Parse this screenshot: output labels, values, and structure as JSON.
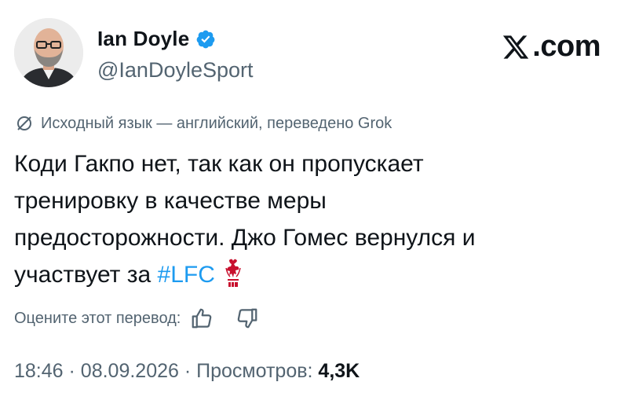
{
  "author": {
    "name": "Ian Doyle",
    "handle": "@IanDoyleSport",
    "verified": true
  },
  "brand": {
    "text": ".com",
    "icon": "x-logo-icon"
  },
  "translation": {
    "note": "Исходный язык — английский, переведено Grok",
    "icon": "translate-slash-icon"
  },
  "tweet": {
    "line1": "Коди Гакпо нет, так как он пропускает",
    "line2": "тренировку в качестве меры",
    "line3": "предосторожности. Джо Гомес вернулся и",
    "line4_prefix": "участвует за ",
    "hashtag": "#LFC",
    "emoji_icon": "lfc-crest-icon"
  },
  "rating": {
    "label": "Оцените этот перевод:",
    "thumbs_up_icon": "thumbs-up-icon",
    "thumbs_down_icon": "thumbs-down-icon"
  },
  "meta": {
    "time": "18:46",
    "date": "08.09.2026",
    "views_label": "Просмотров:",
    "views_count": "4,3K",
    "separator": "·"
  },
  "colors": {
    "text": "#0f1419",
    "secondary": "#536471",
    "link": "#1d9bf0",
    "verified": "#1d9bf0",
    "lfc_red": "#c8102e"
  }
}
